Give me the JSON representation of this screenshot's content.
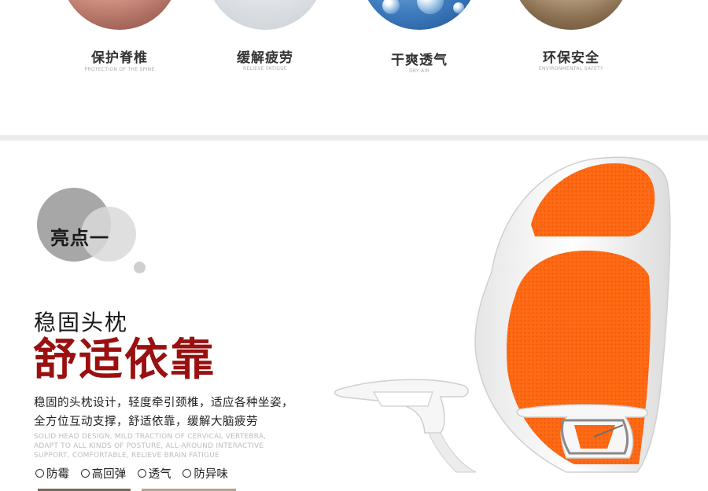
{
  "features": [
    {
      "title": "保护脊椎",
      "subtitle": "PROTECTION OF THE SPINE",
      "image_icon": "hands-massaging-back-photo"
    },
    {
      "title": "缓解疲劳",
      "subtitle": "RELIEVE FATIGUE",
      "image_icon": "office-person-photo"
    },
    {
      "title": "干爽透气",
      "subtitle": "DRY AIR",
      "image_icon": "water-droplets-photo"
    },
    {
      "title": "环保安全",
      "subtitle": "ENVIRONMENTAL SAFETY",
      "image_icon": "hands-holding-soil-photo"
    }
  ],
  "highlight": {
    "badge": "亮点一",
    "subtitle": "稳固头枕",
    "title": "舒适依靠",
    "description_lines": [
      "稳固的头枕设计，轻度牵引颈椎，适应各种坐姿，",
      "全方位互动支撑，舒适依靠，缓解大脑疲劳"
    ],
    "english_lines": [
      "SOLID HEAD DESIGN, MILD TRACTION OF CERVICAL VERTEBRA,",
      "ADAPT TO ALL KINDS OF POSTURE, ALL-AROUND INTERACTIVE",
      "SUPPORT, COMFORTABLE, RELIEVE BRAIN FATIGUE"
    ],
    "tags": [
      "防霉",
      "高回弹",
      "透气",
      "防异味"
    ],
    "product_image": "orange-mesh-office-chair"
  },
  "colors": {
    "title_red": "#9a1010",
    "mesh_orange": "#ff6a1a",
    "frame_white": "#f4f4f4"
  }
}
